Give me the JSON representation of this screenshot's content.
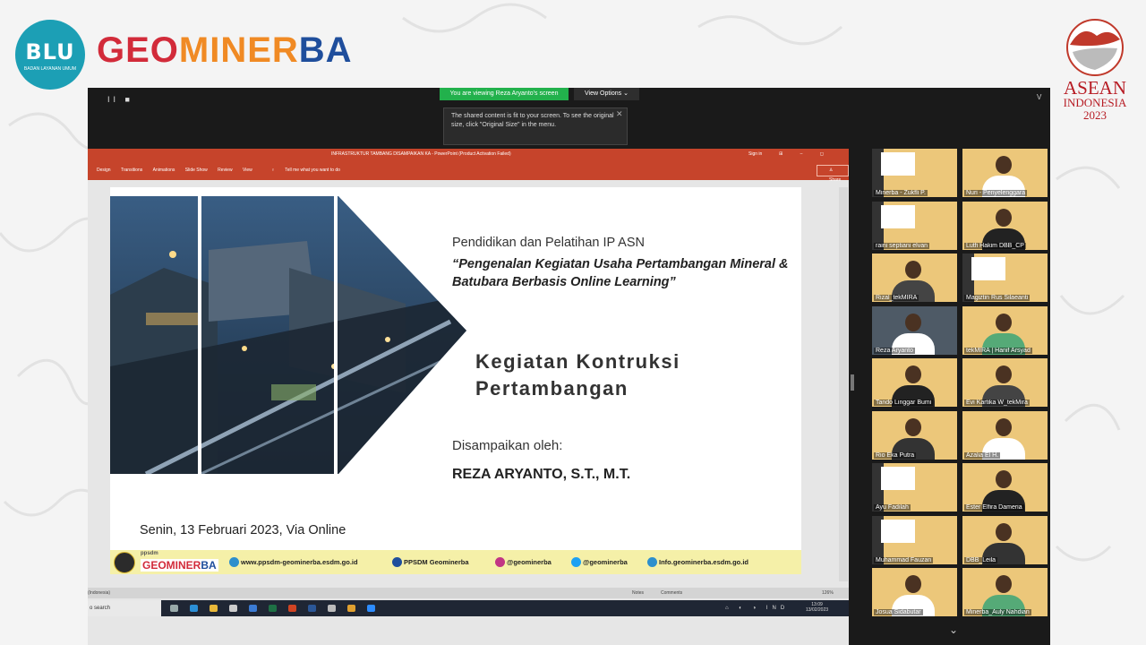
{
  "branding": {
    "blu": "BLU",
    "blu_sub": "BADAN LAYANAN UMUM",
    "geo_a": "GEO",
    "geo_b": "MINER",
    "geo_c": "BA",
    "asean_1": "ASEAN",
    "asean_2": "INDONESIA",
    "asean_3": "2023"
  },
  "zoom": {
    "controls": "II ■",
    "banner": "You are viewing Reza Aryanto's screen",
    "view_options": "View Options",
    "tip_text": "The shared content is fit to your screen. To see the original size, click \"Original Size\" in the menu.",
    "top_right": "V"
  },
  "ppt": {
    "titlebar": "INFRASTRUKTUR TAMBANG DISAMPAIKAN KA - PowerPoint (Product Activation Failed)",
    "sign_in": "Sign in",
    "window_buttons": "⊞ – ◻ ✕",
    "ribbon_tabs": [
      "Design",
      "Transitions",
      "Animations",
      "Slide Show",
      "Review",
      "View",
      "Tell me what you want to do"
    ],
    "share": "Share",
    "status_left": "(Indonesia)",
    "status_notes": "Notes",
    "status_comments": "Comments",
    "status_zoom": "126%"
  },
  "slide": {
    "line1": "Pendidikan dan Pelatihan IP ASN",
    "line2a": "“Pengenalan Kegiatan Usaha Pertambangan Mineral &",
    "line2b": "Batubara Berbasis Online Learning”",
    "title1": "Kegiatan Kontruksi",
    "title2": "Pertambangan",
    "presented_by": "Disampaikan oleh:",
    "presenter": "REZA ARYANTO, S.T., M.T.",
    "date": "Senin, 13 Februari 2023, Via Online",
    "footer": {
      "logo_small": "ppsdm",
      "logo_big_a": "GEOMINER",
      "logo_big_b": "BA",
      "web": "www.ppsdm-geominerba.esdm.go.id",
      "fb": "PPSDM Geominerba",
      "ig": "@geominerba",
      "tw": "@geominerba",
      "mail": "Info.geominerba.esdm.go.id"
    }
  },
  "taskbar": {
    "search": "o search",
    "sys": "⌂ ◐ ◑ IND",
    "time": "13:09",
    "date": "13/02/2023"
  },
  "participants": [
    {
      "name": "Minerba - Zukfli P."
    },
    {
      "name": "Nuri - Penyelenggara"
    },
    {
      "name": "raini septiani elvan"
    },
    {
      "name": "Lutfi Hakim DBB_CP"
    },
    {
      "name": "Rizal_tekMIRA"
    },
    {
      "name": "Magiztin Rus Silaeanti"
    },
    {
      "name": "Reza Aryanto"
    },
    {
      "name": "tekMIRA | Hanif Arsyad"
    },
    {
      "name": "Tando Linggar Bumi"
    },
    {
      "name": "Evi Kartika W_tekMira"
    },
    {
      "name": "Rio Eka Putra"
    },
    {
      "name": "Azalia El H."
    },
    {
      "name": "Ayu Fadilah"
    },
    {
      "name": "Ester Elfira Dameria"
    },
    {
      "name": "Muhammad Fauzan"
    },
    {
      "name": "DBB_Leila"
    },
    {
      "name": "Josua Sidabutar"
    },
    {
      "name": "Minerba_Auly Nahdian"
    }
  ],
  "colors": {
    "accent_green": "#22b14c",
    "ppt_red": "#c6442b",
    "brand_red": "#d22b3a",
    "brand_blue": "#1f4e9c"
  }
}
